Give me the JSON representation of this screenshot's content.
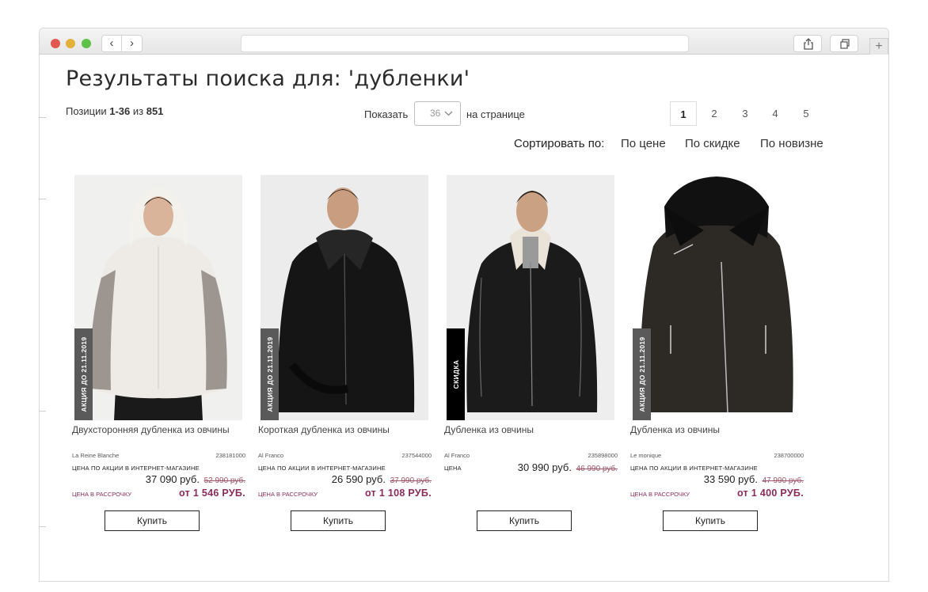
{
  "browser": {
    "back_label": "‹",
    "forward_label": "›",
    "new_tab_label": "+"
  },
  "page": {
    "title": "Результаты поиска для: 'дубленки'",
    "positions_prefix": "Позиции ",
    "positions_range": "1-36",
    "positions_of": " из ",
    "positions_total": "851",
    "show_label": "Показать",
    "per_page_value": "36",
    "on_page_label": "на странице"
  },
  "pagination": {
    "pages": [
      "1",
      "2",
      "3",
      "4",
      "5"
    ],
    "active": "1"
  },
  "sort": {
    "label": "Сортировать по:",
    "options": [
      "По цене",
      "По скидке",
      "По новизне"
    ]
  },
  "products": [
    {
      "badge": "АКЦИЯ ДО 21.11.2019",
      "name": "Двухсторонняя дубленка из овчины",
      "brand": "La Reine Blanche",
      "sku": "238181000",
      "price_label": "ЦЕНА ПО АКЦИИ В ИНТЕРНЕТ-МАГАЗИНЕ",
      "price": "37 090 руб.",
      "old_price": "52 990 руб.",
      "installment_label": "ЦЕНА В РАССРОЧКУ",
      "installment": "от 1 546 РУБ.",
      "buy_label": "Купить"
    },
    {
      "badge": "АКЦИЯ ДО 21.11.2019",
      "name": "Короткая дубленка из овчины",
      "brand": "Al Franco",
      "sku": "237544000",
      "price_label": "ЦЕНА ПО АКЦИИ В ИНТЕРНЕТ-МАГАЗИНЕ",
      "price": "26 590 руб.",
      "old_price": "37 990 руб.",
      "installment_label": "ЦЕНА В РАССРОЧКУ",
      "installment": "от 1 108 РУБ.",
      "buy_label": "Купить"
    },
    {
      "badge": "СКИДКА",
      "name": "Дубленка из овчины",
      "brand": "Al Franco",
      "sku": "235898000",
      "price_label": "ЦЕНА",
      "price": "30 990 руб.",
      "old_price": "46 990 руб.",
      "buy_label": "Купить"
    },
    {
      "badge": "АКЦИЯ ДО 21.11.2019",
      "name": "Дубленка из овчины",
      "brand": "Le monique",
      "sku": "238700000",
      "price_label": "ЦЕНА ПО АКЦИИ В ИНТЕРНЕТ-МАГАЗИНЕ",
      "price": "33 590 руб.",
      "old_price": "47 990 руб.",
      "installment_label": "ЦЕНА В РАССРОЧКУ",
      "installment": "от 1 400 РУБ.",
      "buy_label": "Купить"
    }
  ],
  "colors": {
    "accent": "#8a2b5b",
    "strike": "#a0566a",
    "badge_grey": "#5a5a5a",
    "badge_black": "#000000"
  }
}
